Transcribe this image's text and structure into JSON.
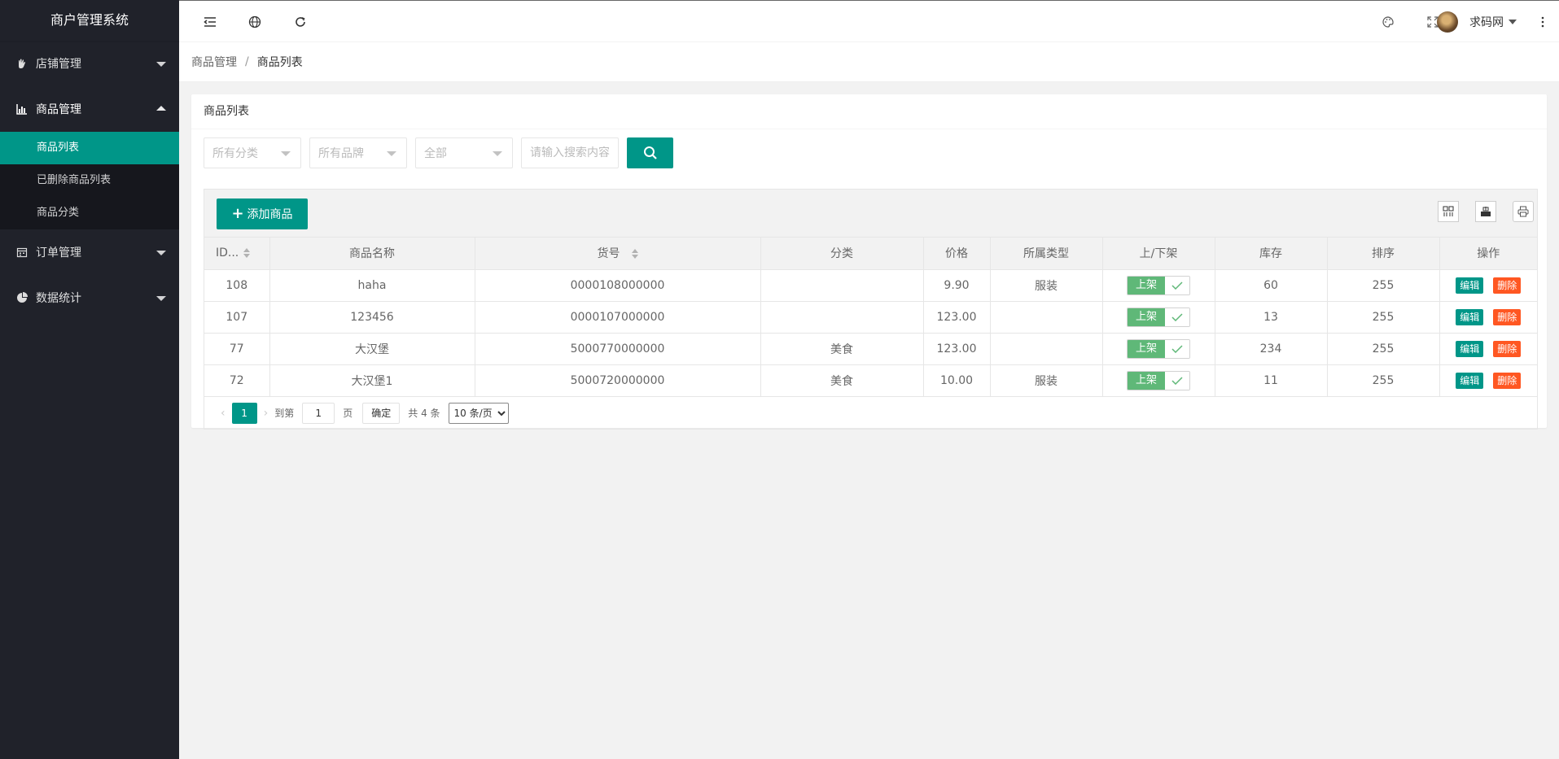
{
  "sidebar": {
    "logo": "商户管理系统",
    "groups": [
      {
        "label": "店铺管理",
        "icon": "hand-icon"
      },
      {
        "label": "商品管理",
        "icon": "chart-icon",
        "items": [
          "商品列表",
          "已删除商品列表",
          "商品分类"
        ],
        "active": "商品列表"
      },
      {
        "label": "订单管理",
        "icon": "calendar-icon"
      },
      {
        "label": "数据统计",
        "icon": "pie-icon"
      }
    ]
  },
  "header": {
    "user_name": "求码网"
  },
  "breadcrumb": {
    "parent": "商品管理",
    "separator": "/",
    "current": "商品列表"
  },
  "card": {
    "title": "商品列表",
    "filters": {
      "category": "所有分类",
      "brand": "所有品牌",
      "status": "全部",
      "search_placeholder": "请输入搜索内容"
    },
    "add_label": "添加商品"
  },
  "table": {
    "columns": [
      "ID...",
      "商品名称",
      "货号",
      "分类",
      "价格",
      "所属类型",
      "上/下架",
      "库存",
      "排序",
      "操作"
    ],
    "rows": [
      {
        "id": "108",
        "name": "haha",
        "sn": "0000108000000",
        "category": "",
        "price": "9.90",
        "type": "服装",
        "onsale": "上架",
        "stock": "60",
        "sort": "255"
      },
      {
        "id": "107",
        "name": "123456",
        "sn": "0000107000000",
        "category": "",
        "price": "123.00",
        "type": "",
        "onsale": "上架",
        "stock": "13",
        "sort": "255"
      },
      {
        "id": "77",
        "name": "大汉堡",
        "sn": "5000770000000",
        "category": "美食",
        "price": "123.00",
        "type": "",
        "onsale": "上架",
        "stock": "234",
        "sort": "255"
      },
      {
        "id": "72",
        "name": "大汉堡1",
        "sn": "5000720000000",
        "category": "美食",
        "price": "10.00",
        "type": "服装",
        "onsale": "上架",
        "stock": "11",
        "sort": "255"
      }
    ],
    "edit_label": "编辑",
    "delete_label": "删除"
  },
  "pager": {
    "current": "1",
    "goto_label": "到第",
    "goto_value": "1",
    "page_label": "页",
    "confirm_label": "确定",
    "total_label": "共 4 条",
    "page_size": "10 条/页"
  },
  "colors": {
    "accent": "#009688",
    "danger": "#ff5722",
    "switch_on": "#5fb878",
    "sidebar_bg": "#20222a"
  }
}
